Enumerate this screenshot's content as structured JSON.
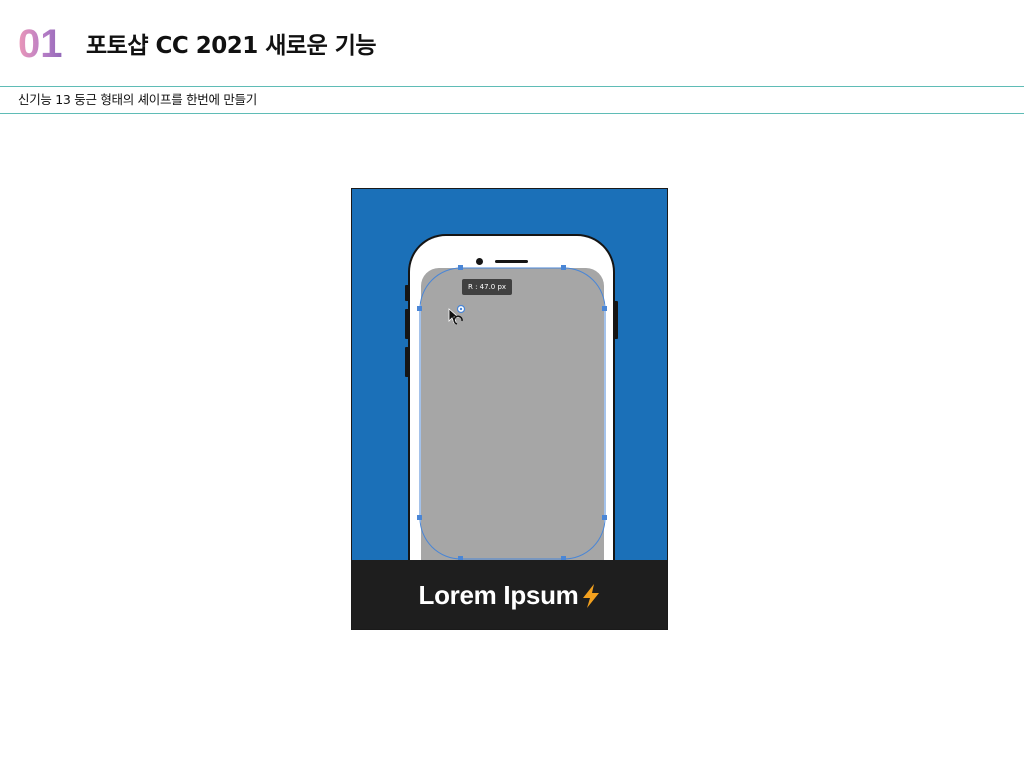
{
  "header": {
    "number": "01",
    "title": "포토샵 CC 2021 새로운 기능"
  },
  "subtitle": "신기능 13 둥근 형태의 셰이프를 한번에 만들기",
  "illustration": {
    "tooltip": "R : 47.0 px",
    "banner_text": "Lorem Ipsum",
    "icons": {
      "bolt": "lightning-bolt-icon",
      "cursor": "arrow-cursor-icon",
      "rotate": "corner-radius-rotate-icon"
    },
    "colors": {
      "background": "#1b70b8",
      "screen": "#a6a6a6",
      "banner": "#1e1e1e",
      "bolt": "#f2a01e",
      "selection": "#4a86d6"
    }
  }
}
